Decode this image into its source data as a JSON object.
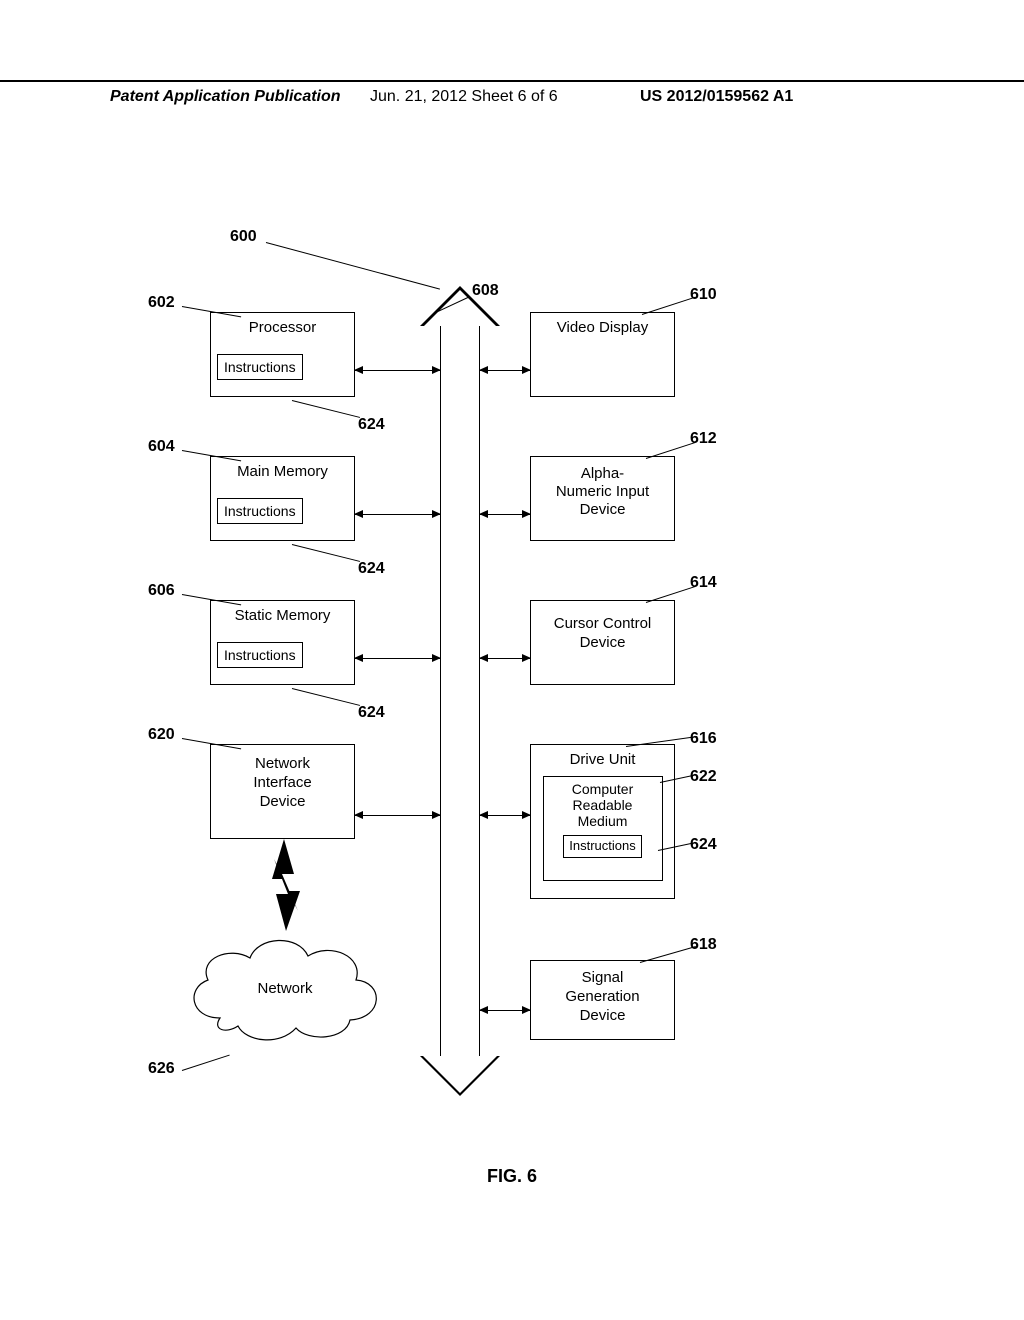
{
  "header": {
    "left": "Patent Application Publication",
    "center": "Jun. 21, 2012  Sheet 6 of 6",
    "right": "US 2012/0159562 A1"
  },
  "figure_caption": "FIG. 6",
  "refs": {
    "r600": "600",
    "r602": "602",
    "r604": "604",
    "r606": "606",
    "r608": "608",
    "r610": "610",
    "r612": "612",
    "r614": "614",
    "r616": "616",
    "r618": "618",
    "r620": "620",
    "r622": "622",
    "r624a": "624",
    "r624b": "624",
    "r624c": "624",
    "r624d": "624",
    "r626": "626"
  },
  "boxes": {
    "processor": "Processor",
    "processor_inner": "Instructions",
    "main_memory": "Main Memory",
    "main_memory_inner": "Instructions",
    "static_memory": "Static Memory",
    "static_memory_inner": "Instructions",
    "nid": "Network\nInterface\nDevice",
    "video": "Video Display",
    "alpha": "Alpha-\nNumeric Input\nDevice",
    "cursor": "Cursor Control\nDevice",
    "drive": "Drive Unit",
    "crm": "Computer\nReadable\nMedium",
    "crm_inner": "Instructions",
    "sig": "Signal\nGeneration\nDevice",
    "network": "Network"
  }
}
